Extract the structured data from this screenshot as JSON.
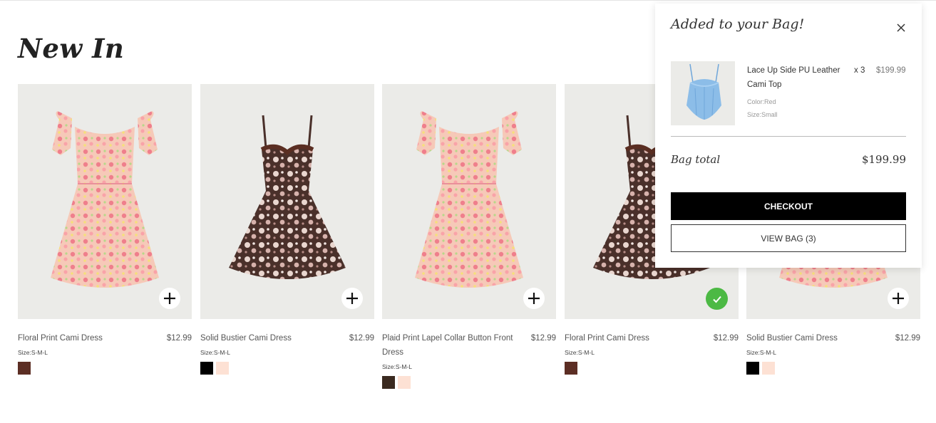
{
  "page": {
    "title": "New In"
  },
  "products": [
    {
      "name": "Floral Print Cami Dress",
      "price": "$12.99",
      "sizes": "Size:S-M-L",
      "style": "pink-puff",
      "state": "add",
      "swatches": [
        "#5c2e24"
      ]
    },
    {
      "name": "Solid Bustier Cami Dress",
      "price": "$12.99",
      "sizes": "Size:S-M-L",
      "style": "brown-cami",
      "state": "add",
      "swatches": [
        "#000000",
        "#fde1d4"
      ]
    },
    {
      "name": "Plaid Print Lapel Collar Button Front Dress",
      "price": "$12.99",
      "sizes": "Size:S-M-L",
      "style": "pink-puff",
      "state": "add",
      "swatches": [
        "#3a2a20",
        "#fde1d4"
      ]
    },
    {
      "name": "Floral Print Cami Dress",
      "price": "$12.99",
      "sizes": "Size:S-M-L",
      "style": "brown-cami",
      "state": "added",
      "swatches": [
        "#5c2e24"
      ]
    },
    {
      "name": "Solid Bustier Cami Dress",
      "price": "$12.99",
      "sizes": "Size:S-M-L",
      "style": "pink-puff",
      "state": "add",
      "swatches": [
        "#000000",
        "#fde1d4"
      ]
    }
  ],
  "bag": {
    "title": "Added to your Bag!",
    "item": {
      "name": "Lace Up Side PU Leather Cami Top",
      "qty": "x 3",
      "price": "$199.99",
      "color": "Color:Red",
      "size": "Size:Small"
    },
    "total_label": "Bag total",
    "total_value": "$199.99",
    "checkout_label": "CHECKOUT",
    "view_bag_label": "VIEW BAG (3)"
  },
  "icons": {
    "add": "plus-icon",
    "added": "check-icon",
    "close": "close-icon"
  },
  "colors": {
    "added_green": "#4cb944",
    "checkout_bg": "#000000"
  }
}
